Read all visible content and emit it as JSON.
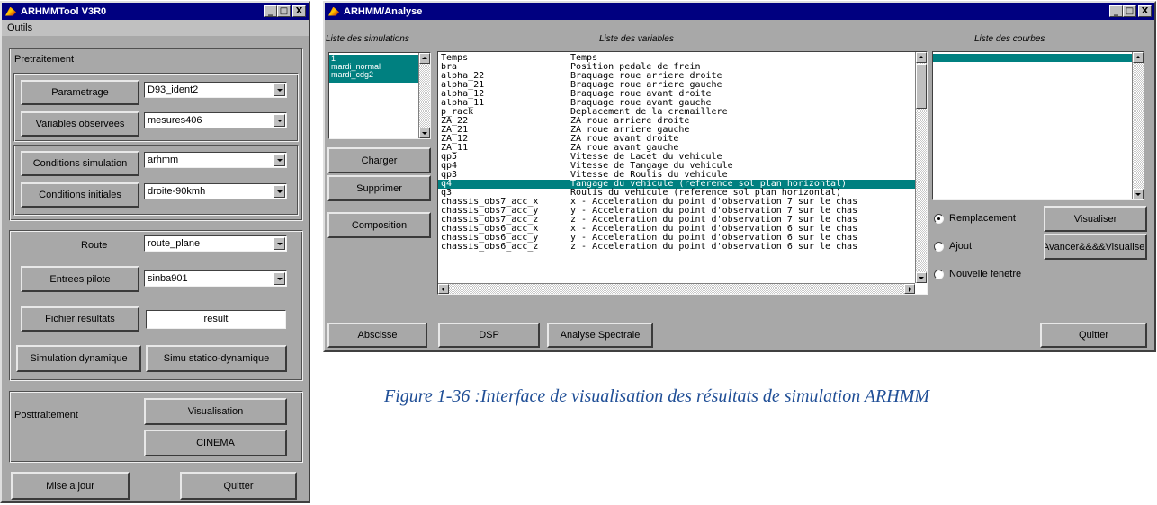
{
  "left_window": {
    "title": "ARHMMTool V3R0",
    "title_buttons": [
      "_",
      "□",
      "X"
    ],
    "menu": [
      "Outils"
    ],
    "pretraitement": {
      "title": "Pretraitement",
      "parametrage": {
        "label": "Parametrage",
        "value": "D93_ident2"
      },
      "variables_observees": {
        "label": "Variables observees",
        "value": "mesures406"
      },
      "conditions_simulation": {
        "label": "Conditions simulation",
        "value": "arhmm"
      },
      "conditions_initiales": {
        "label": "Conditions initiales",
        "value": "droite-90kmh"
      }
    },
    "simulation": {
      "route": {
        "label": "Route",
        "value": "route_plane"
      },
      "entrees_pilote": {
        "label": "Entrees pilote",
        "value": "sinba901"
      },
      "fichier_resultats": {
        "label": "Fichier resultats",
        "value": "result"
      },
      "simulation_dynamique_label": "Simulation dynamique",
      "simu_statico_label": "Simu statico-dynamique"
    },
    "posttraitement": {
      "title": "Posttraitement",
      "visualisation_label": "Visualisation",
      "cinema_label": "CINEMA"
    },
    "mise_a_jour_label": "Mise a jour",
    "quitter_label": "Quitter"
  },
  "right_window": {
    "title": "ARHMM/Analyse",
    "title_buttons": [
      "_",
      "□",
      "X"
    ],
    "headers": {
      "simulations": "Liste des simulations",
      "variables": "Liste des variables",
      "courbes": "Liste des courbes"
    },
    "simulations": [
      "1",
      "mardi_normal",
      "mardi_cdg2"
    ],
    "variables": [
      {
        "name": "Temps",
        "desc": "Temps"
      },
      {
        "name": "bra",
        "desc": "Position pedale de frein"
      },
      {
        "name": "alpha_22",
        "desc": "Braquage roue arriere droite"
      },
      {
        "name": "alpha_21",
        "desc": "Braquage roue arriere gauche"
      },
      {
        "name": "alpha_12",
        "desc": "Braquage roue avant droite"
      },
      {
        "name": "alpha_11",
        "desc": "Braquage roue avant gauche"
      },
      {
        "name": "p_rack",
        "desc": "Deplacement de la cremaillere"
      },
      {
        "name": "ZA_22",
        "desc": "ZA roue arriere droite"
      },
      {
        "name": "ZA_21",
        "desc": "ZA roue arriere gauche"
      },
      {
        "name": "ZA_12",
        "desc": "ZA roue avant droite"
      },
      {
        "name": "ZA_11",
        "desc": "ZA roue avant gauche"
      },
      {
        "name": "qp5",
        "desc": "Vitesse de Lacet du vehicule"
      },
      {
        "name": "qp4",
        "desc": "Vitesse de Tangage du vehicule"
      },
      {
        "name": "qp3",
        "desc": "Vitesse de Roulis du vehicule"
      },
      {
        "name": "q4",
        "desc": "Tangage du vehicule (reference sol plan horizontal)"
      },
      {
        "name": "q3",
        "desc": "Roulis du vehicule (reference sol plan horizontal)"
      },
      {
        "name": "chassis_obs7_acc_x",
        "desc": "x - Acceleration du point d'observation 7 sur le chas"
      },
      {
        "name": "chassis_obs7_acc_y",
        "desc": "y - Acceleration du point d'observation 7 sur le chas"
      },
      {
        "name": "chassis_obs7_acc_z",
        "desc": "z - Acceleration du point d'observation 7 sur le chas"
      },
      {
        "name": "chassis_obs6_acc_x",
        "desc": "x - Acceleration du point d'observation 6 sur le chas"
      },
      {
        "name": "chassis_obs6_acc_y",
        "desc": "y - Acceleration du point d'observation 6 sur le chas"
      },
      {
        "name": "chassis_obs6_acc_z",
        "desc": "z - Acceleration du point d'observation 6 sur le chas"
      }
    ],
    "selected_variable": "q4",
    "buttons": {
      "charger": "Charger",
      "supprimer": "Supprimer",
      "composition": "Composition",
      "visualiser": "Visualiser",
      "avancer": "Avancer&&&&Visualiser",
      "abscisse": "Abscisse",
      "dsp": "DSP",
      "analyse_spectrale": "Analyse Spectrale",
      "quitter": "Quitter"
    },
    "modes": [
      {
        "label": "Remplacement",
        "checked": true
      },
      {
        "label": "Ajout",
        "checked": false
      },
      {
        "label": "Nouvelle fenetre",
        "checked": false
      }
    ]
  },
  "caption": "Figure 1-36 :Interface de visualisation des résultats de simulation ARHMM",
  "colors": {
    "titlebar": "#000080",
    "selection": "#008080",
    "window": "#a8a8a8",
    "caption": "#1f4e96"
  }
}
